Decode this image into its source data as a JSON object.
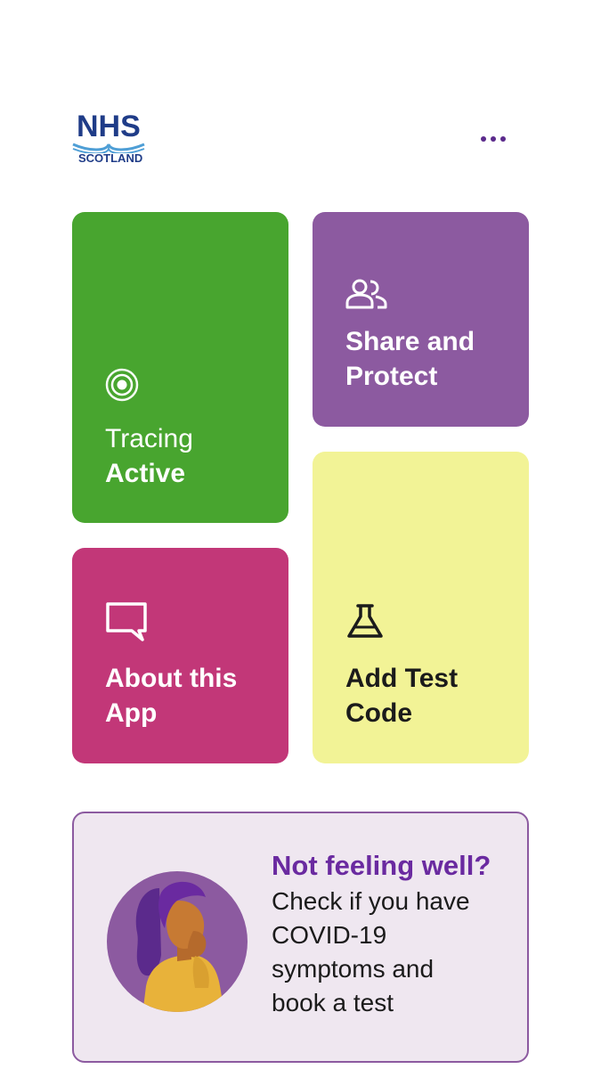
{
  "header": {
    "logo_main": "NHS",
    "logo_sub": "SCOTLAND",
    "menu_icon": "more-horizontal-icon"
  },
  "tiles": {
    "tracing": {
      "line1": "Tracing",
      "line2": "Active",
      "icon": "target-icon",
      "color": "#48a52f"
    },
    "share": {
      "line1": "Share and",
      "line2": "Protect",
      "icon": "people-icon",
      "color": "#8c5aa0"
    },
    "about": {
      "line1": "About this",
      "line2": "App",
      "icon": "chat-bubble-icon",
      "color": "#c23778"
    },
    "test": {
      "line1": "Add Test",
      "line2": "Code",
      "icon": "flask-icon",
      "color": "#f2f396"
    }
  },
  "card": {
    "title": "Not feeling well?",
    "line1": "Check if you have",
    "line2": "COVID-19",
    "line3": "symptoms and",
    "line4": "book a test",
    "illustration": "person-unwell-illustration"
  },
  "colors": {
    "brand_blue": "#1f3c88",
    "brand_purple": "#6a2aa0",
    "card_bg": "#efe7f0"
  }
}
